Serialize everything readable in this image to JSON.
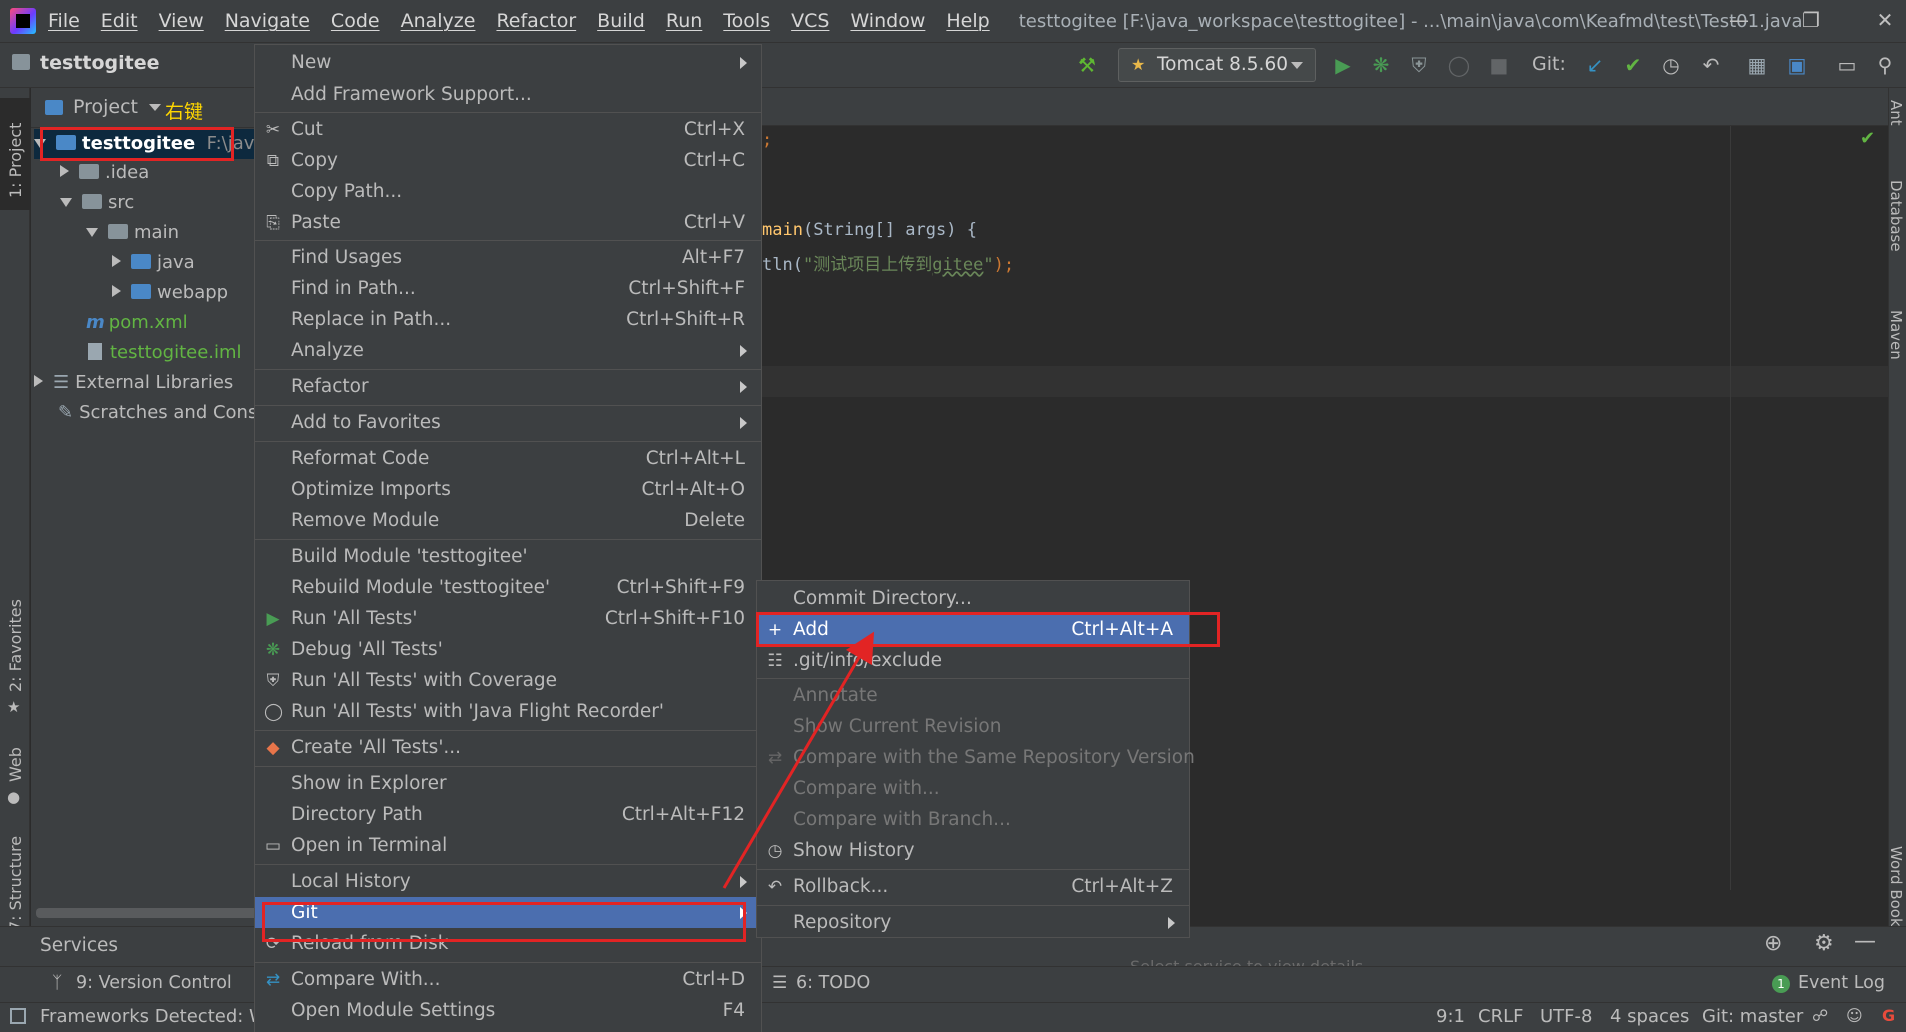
{
  "menubar": {
    "items": [
      "File",
      "Edit",
      "View",
      "Navigate",
      "Code",
      "Analyze",
      "Refactor",
      "Build",
      "Run",
      "Tools",
      "VCS",
      "Window",
      "Help"
    ],
    "window_title": "testtogitee [F:\\java_workspace\\testtogitee] - ...\\main\\java\\com\\Keafmd\\test\\Test01.java"
  },
  "toolbar": {
    "project_name": "testtogitee",
    "run_config": "Tomcat 8.5.60",
    "git_label": "Git:"
  },
  "left_strip": {
    "project": "1: Project",
    "favorites": "2: Favorites",
    "web": "Web",
    "structure": "7: Structure"
  },
  "right_strip": {
    "ant": "Ant",
    "database": "Database",
    "maven": "Maven",
    "word_book": "Word Book"
  },
  "project_panel": {
    "header": "Project",
    "annotation": "右键",
    "root": {
      "name": "testtogitee",
      "path": "F:\\java"
    },
    "nodes": [
      ".idea",
      "src",
      "main",
      "java",
      "webapp",
      "pom.xml",
      "testtogitee.iml",
      "External Libraries",
      "Scratches and Cons"
    ]
  },
  "editor": {
    "line1_suffix": ";",
    "line2_method": "main",
    "line2_rest": "(String[] args) {",
    "line3_prefix": "tln(",
    "line3_string_a": "\"测试项目上传到",
    "line3_string_b": "gitee",
    "line3_string_c": "\"",
    "line3_end": ");"
  },
  "context_menu": {
    "items": [
      {
        "label": "New",
        "shortcut": ""
      },
      {
        "label": "Add Framework Support...",
        "shortcut": ""
      },
      {
        "label": "Cut",
        "shortcut": "Ctrl+X"
      },
      {
        "label": "Copy",
        "shortcut": "Ctrl+C"
      },
      {
        "label": "Copy Path...",
        "shortcut": ""
      },
      {
        "label": "Paste",
        "shortcut": "Ctrl+V"
      },
      {
        "label": "Find Usages",
        "shortcut": "Alt+F7"
      },
      {
        "label": "Find in Path...",
        "shortcut": "Ctrl+Shift+F"
      },
      {
        "label": "Replace in Path...",
        "shortcut": "Ctrl+Shift+R"
      },
      {
        "label": "Analyze",
        "shortcut": ""
      },
      {
        "label": "Refactor",
        "shortcut": ""
      },
      {
        "label": "Add to Favorites",
        "shortcut": ""
      },
      {
        "label": "Reformat Code",
        "shortcut": "Ctrl+Alt+L"
      },
      {
        "label": "Optimize Imports",
        "shortcut": "Ctrl+Alt+O"
      },
      {
        "label": "Remove Module",
        "shortcut": "Delete"
      },
      {
        "label": "Build Module 'testtogitee'",
        "shortcut": ""
      },
      {
        "label": "Rebuild Module 'testtogitee'",
        "shortcut": "Ctrl+Shift+F9"
      },
      {
        "label": "Run 'All Tests'",
        "shortcut": "Ctrl+Shift+F10"
      },
      {
        "label": "Debug 'All Tests'",
        "shortcut": ""
      },
      {
        "label": "Run 'All Tests' with Coverage",
        "shortcut": ""
      },
      {
        "label": "Run 'All Tests' with 'Java Flight Recorder'",
        "shortcut": ""
      },
      {
        "label": "Create 'All Tests'...",
        "shortcut": ""
      },
      {
        "label": "Show in Explorer",
        "shortcut": ""
      },
      {
        "label": "Directory Path",
        "shortcut": "Ctrl+Alt+F12"
      },
      {
        "label": "Open in Terminal",
        "shortcut": ""
      },
      {
        "label": "Local History",
        "shortcut": ""
      },
      {
        "label": "Git",
        "shortcut": ""
      },
      {
        "label": "Reload from Disk",
        "shortcut": ""
      },
      {
        "label": "Compare With...",
        "shortcut": "Ctrl+D"
      },
      {
        "label": "Open Module Settings",
        "shortcut": "F4"
      }
    ]
  },
  "git_submenu": {
    "items": [
      {
        "label": "Commit Directory...",
        "shortcut": ""
      },
      {
        "label": "Add",
        "shortcut": "Ctrl+Alt+A"
      },
      {
        "label": ".git/info/exclude",
        "shortcut": ""
      },
      {
        "label": "Annotate",
        "shortcut": ""
      },
      {
        "label": "Show Current Revision",
        "shortcut": ""
      },
      {
        "label": "Compare with the Same Repository Version",
        "shortcut": ""
      },
      {
        "label": "Compare with...",
        "shortcut": ""
      },
      {
        "label": "Compare with Branch...",
        "shortcut": ""
      },
      {
        "label": "Show History",
        "shortcut": ""
      },
      {
        "label": "Rollback...",
        "shortcut": "Ctrl+Alt+Z"
      },
      {
        "label": "Repository",
        "shortcut": ""
      }
    ]
  },
  "bottom": {
    "services": "Services",
    "version_control": "9: Version Control",
    "todo": "6: TODO",
    "event_log": "Event Log",
    "event_count": "1",
    "hint": "Select service to view details"
  },
  "statusbar": {
    "message": "Frameworks Detected: W",
    "position": "9:1",
    "line_sep": "CRLF",
    "encoding": "UTF-8",
    "indent": "4 spaces",
    "branch": "Git: master"
  },
  "colors": {
    "selection": "#4b6eaf",
    "highlight_box": "#e22424",
    "annotation_text": "#ffd700",
    "menu_bg": "#3c3f41"
  }
}
